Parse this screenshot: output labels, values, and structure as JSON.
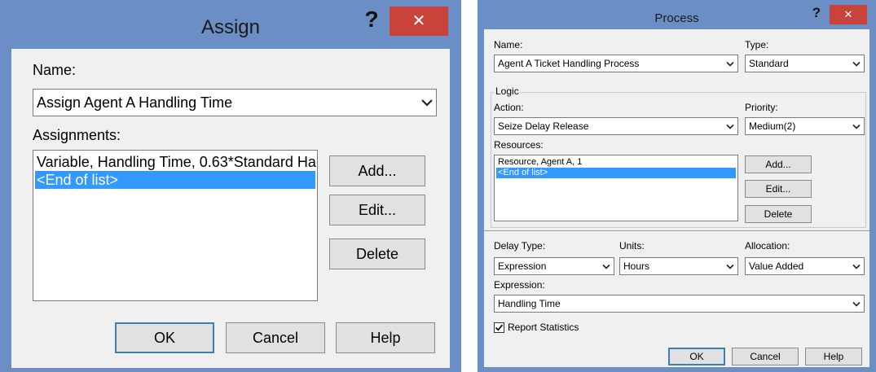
{
  "assign": {
    "title": "Assign",
    "help_glyph": "?",
    "close_glyph": "✕",
    "name_label": "Name:",
    "name_value": "Assign Agent A Handling Time",
    "assignments_label": "Assignments:",
    "assignments": [
      "Variable, Handling Time, 0.63*Standard Ha",
      "<End of list>"
    ],
    "selected_index": 1,
    "add_label": "Add...",
    "edit_label": "Edit...",
    "delete_label": "Delete",
    "ok_label": "OK",
    "cancel_label": "Cancel",
    "help_label": "Help"
  },
  "process": {
    "title": "Process",
    "help_glyph": "?",
    "close_glyph": "✕",
    "name_label": "Name:",
    "name_value": "Agent A Ticket Handling Process",
    "type_label": "Type:",
    "type_value": "Standard",
    "logic_label": "Logic",
    "action_label": "Action:",
    "action_value": "Seize Delay Release",
    "priority_label": "Priority:",
    "priority_value": "Medium(2)",
    "resources_label": "Resources:",
    "resources": [
      "Resource, Agent A, 1",
      "<End of list>"
    ],
    "selected_index": 1,
    "add_label": "Add...",
    "edit_label": "Edit...",
    "delete_label": "Delete",
    "delay_type_label": "Delay Type:",
    "delay_type_value": "Expression",
    "units_label": "Units:",
    "units_value": "Hours",
    "allocation_label": "Allocation:",
    "allocation_value": "Value Added",
    "expression_label": "Expression:",
    "expression_value": "Handling Time",
    "report_statistics_label": "Report Statistics",
    "report_statistics_checked": true,
    "ok_label": "OK",
    "cancel_label": "Cancel",
    "help_label": "Help"
  }
}
